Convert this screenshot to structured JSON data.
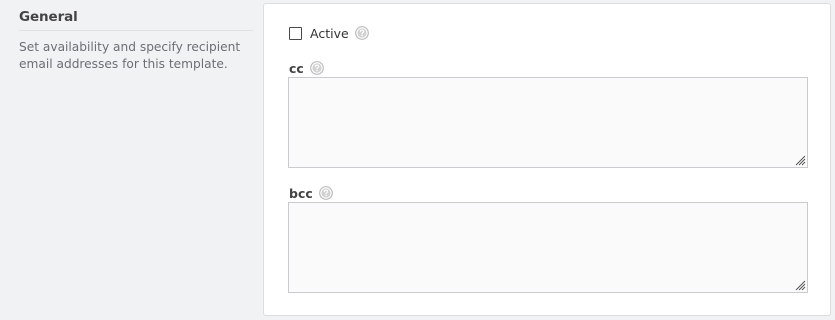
{
  "section": {
    "title": "General",
    "description": "Set availability and specify recipient email addresses for this template."
  },
  "form": {
    "active": {
      "label": "Active",
      "checked": false,
      "help_icon": "question-circle-icon"
    },
    "cc": {
      "label": "cc",
      "value": "",
      "help_icon": "question-circle-icon"
    },
    "bcc": {
      "label": "bcc",
      "value": "",
      "help_icon": "question-circle-icon"
    }
  },
  "colors": {
    "page_background": "#f1f2f4",
    "card_background": "#ffffff",
    "textarea_background": "#fafafa",
    "help_icon": "#bdbdbd"
  }
}
